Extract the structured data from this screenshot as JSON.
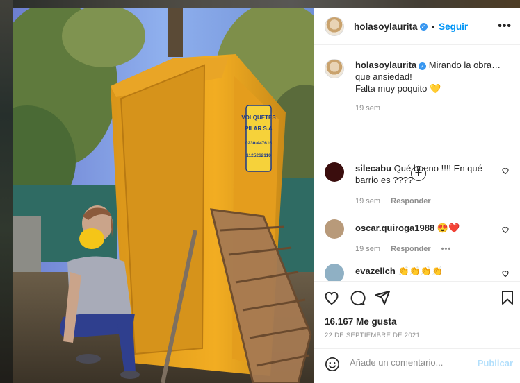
{
  "post": {
    "author": "holasoylaurita",
    "follow_label": "Seguir",
    "separator": "•",
    "more_label": "•••",
    "caption": {
      "user": "holasoylaurita",
      "line1": "Mirando la obra…",
      "line2": "que ansiedad!",
      "line3": "Falta muy poquito",
      "emoji": "💛",
      "time": "19 sem"
    },
    "load_more_symbol": "+",
    "comments": [
      {
        "user": "silecabu",
        "text": "Qué bueno !!!! En qué",
        "text2": "barrio es ????",
        "time": "19 sem",
        "reply": "Responder",
        "avatar_color": "#3a0d0d"
      },
      {
        "user": "oscar.quiroga1988",
        "text": "😍❤️",
        "time": "19 sem",
        "reply": "Responder",
        "more": "•••",
        "avatar_color": "#b89a7a"
      },
      {
        "user": "evazelich",
        "text": "👏👏👏👏",
        "avatar_color": "#8fb0c4"
      }
    ],
    "likes": "16.167 Me gusta",
    "date": "22 DE SEPTIEMBRE DE 2021",
    "comment_placeholder": "Añade un comentario...",
    "publish_label": "Publicar"
  },
  "photo": {
    "sign_lines": [
      "VOLQUETES",
      "PILAR S.A",
      "0230-447616",
      "1125262110"
    ]
  }
}
